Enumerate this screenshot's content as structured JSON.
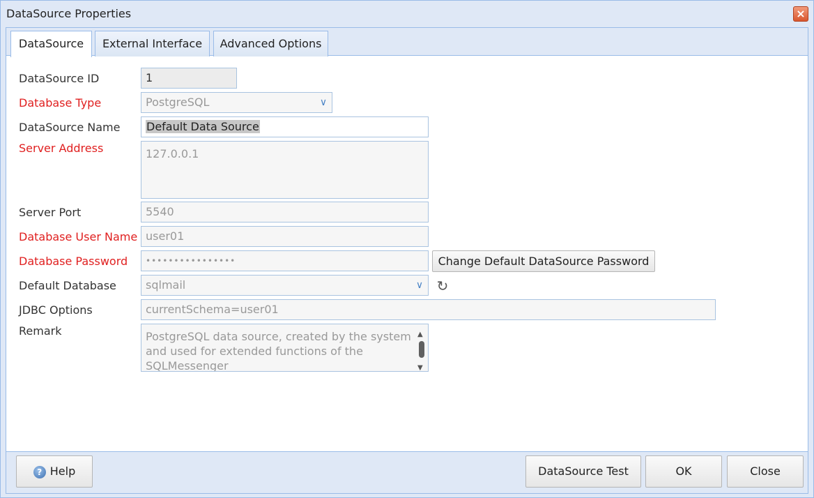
{
  "window": {
    "title": "DataSource Properties"
  },
  "tabs": [
    {
      "label": "DataSource"
    },
    {
      "label": "External Interface"
    },
    {
      "label": "Advanced Options"
    }
  ],
  "form": {
    "datasource_id": {
      "label": "DataSource ID",
      "value": "1"
    },
    "database_type": {
      "label": "Database Type",
      "value": "PostgreSQL"
    },
    "datasource_name": {
      "label": "DataSource Name",
      "value": "Default Data Source"
    },
    "server_address": {
      "label": "Server Address",
      "value": "127.0.0.1"
    },
    "server_port": {
      "label": "Server Port",
      "value": "5540"
    },
    "db_user": {
      "label": "Database User Name",
      "value": "user01"
    },
    "db_password": {
      "label": "Database Password",
      "value": "••••••••••••••••",
      "button": "Change Default DataSource Password"
    },
    "default_db": {
      "label": "Default Database",
      "value": "sqlmail"
    },
    "jdbc_options": {
      "label": "JDBC Options",
      "value": "currentSchema=user01"
    },
    "remark": {
      "label": "Remark",
      "value": "PostgreSQL data source, created by the system and used for extended functions of the SQLMessenger"
    }
  },
  "footer": {
    "help": "Help",
    "test": "DataSource Test",
    "ok": "OK",
    "close": "Close"
  },
  "icons": {
    "close": "close-icon",
    "dropdown": "chevron-down-icon",
    "refresh": "refresh-icon",
    "help": "help-icon"
  },
  "colors": {
    "required_label": "#e02020",
    "chrome": "#dfe8f6",
    "border": "#99bbe8"
  }
}
